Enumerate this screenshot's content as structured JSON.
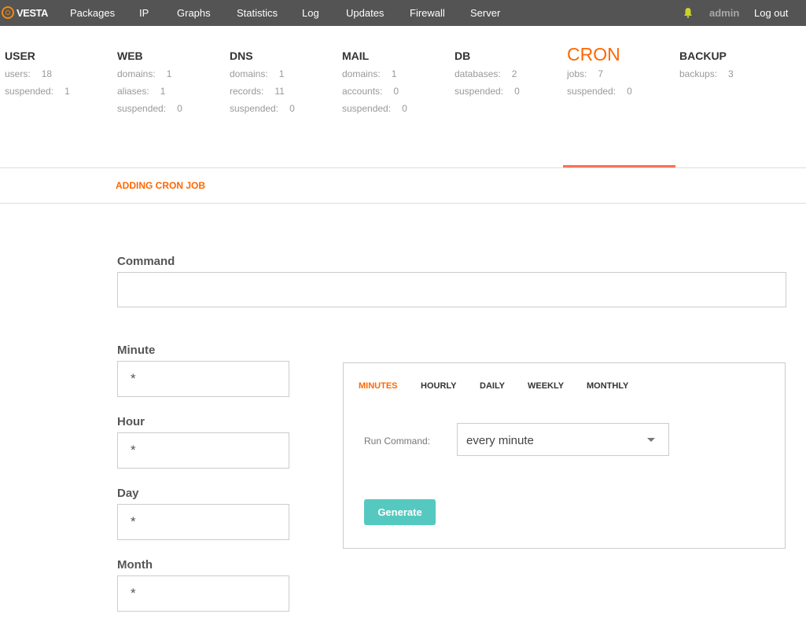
{
  "header": {
    "logo_text": "VESTA",
    "nav": [
      "Packages",
      "IP",
      "Graphs",
      "Statistics",
      "Log",
      "Updates",
      "Firewall",
      "Server"
    ],
    "user": "admin",
    "logout": "Log out",
    "accent_color": "#ff6701"
  },
  "stats": [
    {
      "title": "USER",
      "rows": [
        [
          "users:",
          "18"
        ],
        [
          "suspended:",
          "1"
        ]
      ]
    },
    {
      "title": "WEB",
      "rows": [
        [
          "domains:",
          "1"
        ],
        [
          "aliases:",
          "1"
        ],
        [
          "suspended:",
          "0"
        ]
      ]
    },
    {
      "title": "DNS",
      "rows": [
        [
          "domains:",
          "1"
        ],
        [
          "records:",
          "11"
        ],
        [
          "suspended:",
          "0"
        ]
      ]
    },
    {
      "title": "MAIL",
      "rows": [
        [
          "domains:",
          "1"
        ],
        [
          "accounts:",
          "0"
        ],
        [
          "suspended:",
          "0"
        ]
      ]
    },
    {
      "title": "DB",
      "rows": [
        [
          "databases:",
          "2"
        ],
        [
          "suspended:",
          "0"
        ]
      ]
    },
    {
      "title": "CRON",
      "rows": [
        [
          "jobs:",
          "7"
        ],
        [
          "suspended:",
          "0"
        ]
      ]
    },
    {
      "title": "BACKUP",
      "rows": [
        [
          "backups:",
          "3"
        ]
      ]
    }
  ],
  "page_title": "ADDING CRON JOB",
  "form": {
    "command_label": "Command",
    "command_value": "",
    "minute_label": "Minute",
    "minute_value": "*",
    "hour_label": "Hour",
    "hour_value": "*",
    "day_label": "Day",
    "day_value": "*",
    "month_label": "Month",
    "month_value": "*"
  },
  "generator": {
    "tabs": [
      "MINUTES",
      "HOURLY",
      "DAILY",
      "WEEKLY",
      "MONTHLY"
    ],
    "active_tab": "MINUTES",
    "run_label": "Run Command:",
    "run_value": "every minute",
    "generate_label": "Generate",
    "button_color": "#55c9c0"
  }
}
